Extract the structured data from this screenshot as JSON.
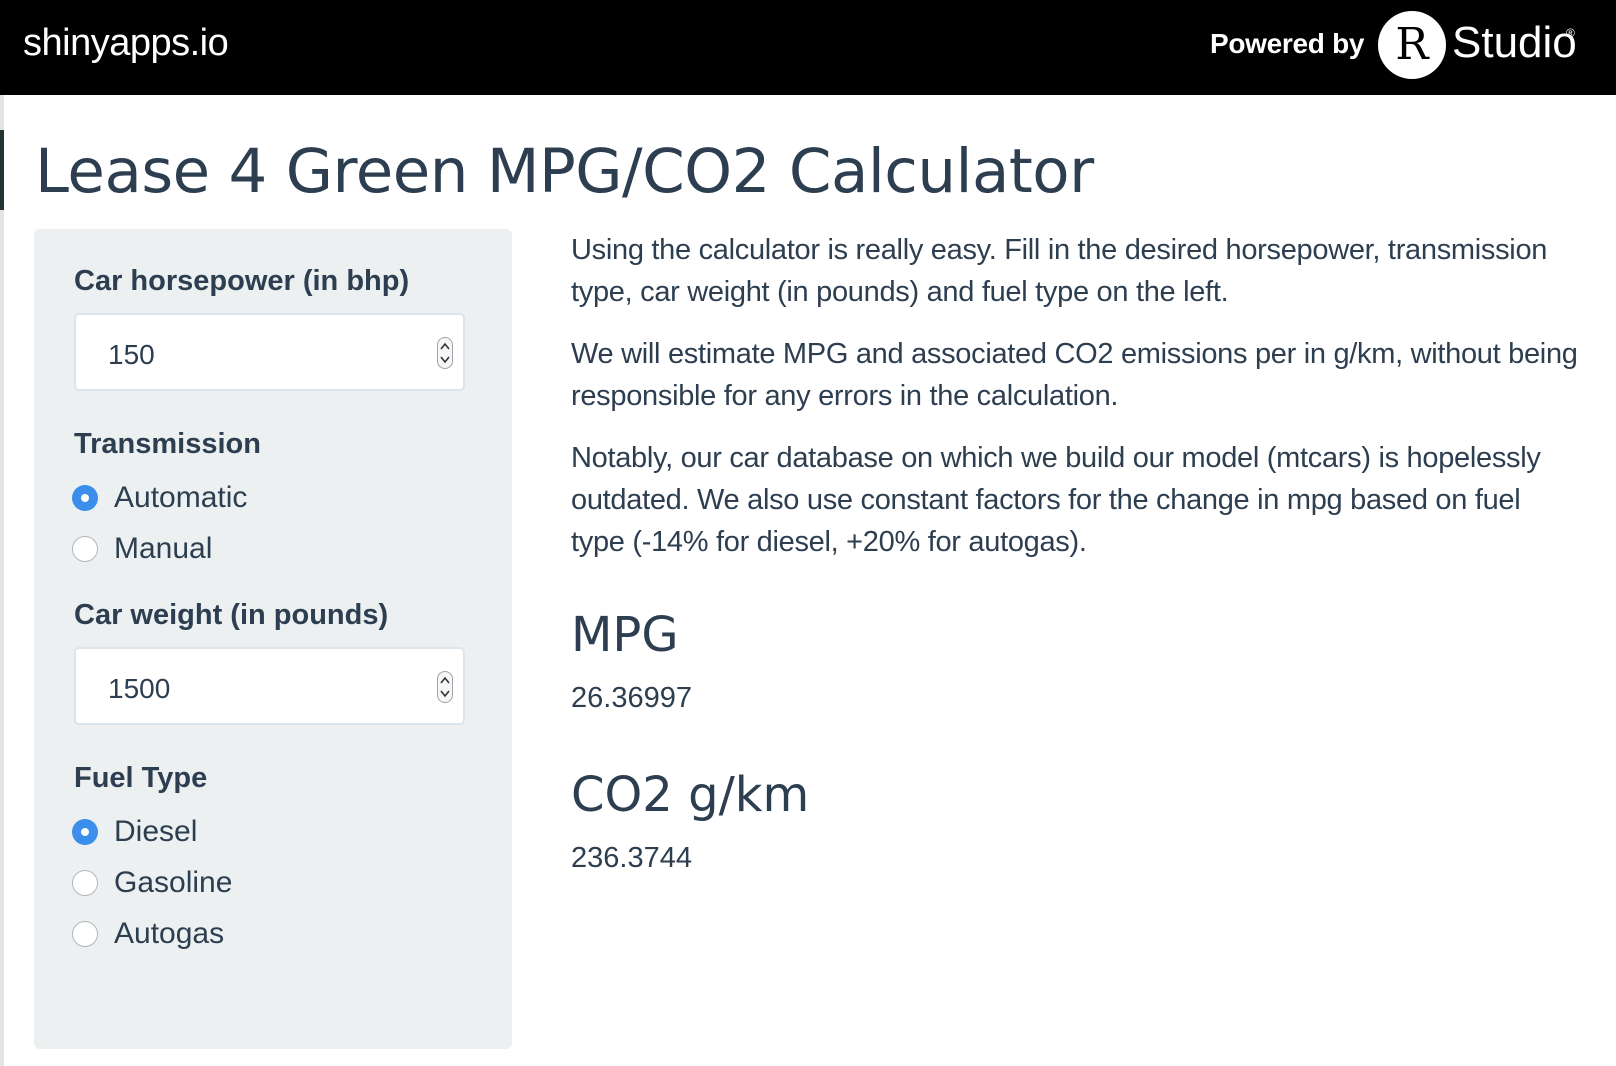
{
  "topbar": {
    "brand": "shinyapps.io",
    "powered_by": "Powered by",
    "logo_letter": "R",
    "logo_text": "Studio",
    "logo_reg": "®"
  },
  "page": {
    "title": "Lease 4 Green MPG/CO2 Calculator"
  },
  "sidebar": {
    "horsepower": {
      "label": "Car horsepower (in bhp)",
      "value": "150"
    },
    "transmission": {
      "label": "Transmission",
      "options": [
        {
          "label": "Automatic",
          "checked": true
        },
        {
          "label": "Manual",
          "checked": false
        }
      ]
    },
    "weight": {
      "label": "Car weight (in pounds)",
      "value": "1500"
    },
    "fuel": {
      "label": "Fuel Type",
      "options": [
        {
          "label": "Diesel",
          "checked": true
        },
        {
          "label": "Gasoline",
          "checked": false
        },
        {
          "label": "Autogas",
          "checked": false
        }
      ]
    }
  },
  "main": {
    "paragraphs": [
      "Using the calculator is really easy. Fill in the desired horsepower, transmission type, car weight (in pounds) and fuel type on the left.",
      "We will estimate MPG and associated CO2 emissions per in g/km, without being responsible for any errors in the calculation.",
      "Notably, our car database on which we build our model (mtcars) is hopelessly outdated. We also use constant factors for the change in mpg based on fuel type (-14% for diesel, +20% for autogas)."
    ],
    "mpg": {
      "heading": "MPG",
      "value": "26.36997"
    },
    "co2": {
      "heading": "CO2 g/km",
      "value": "236.3744"
    }
  },
  "colors": {
    "topbar": "#000000",
    "sidebar_bg": "#ecf0f1",
    "text": "#2c3e50",
    "radio_checked": "#3b8eea"
  }
}
